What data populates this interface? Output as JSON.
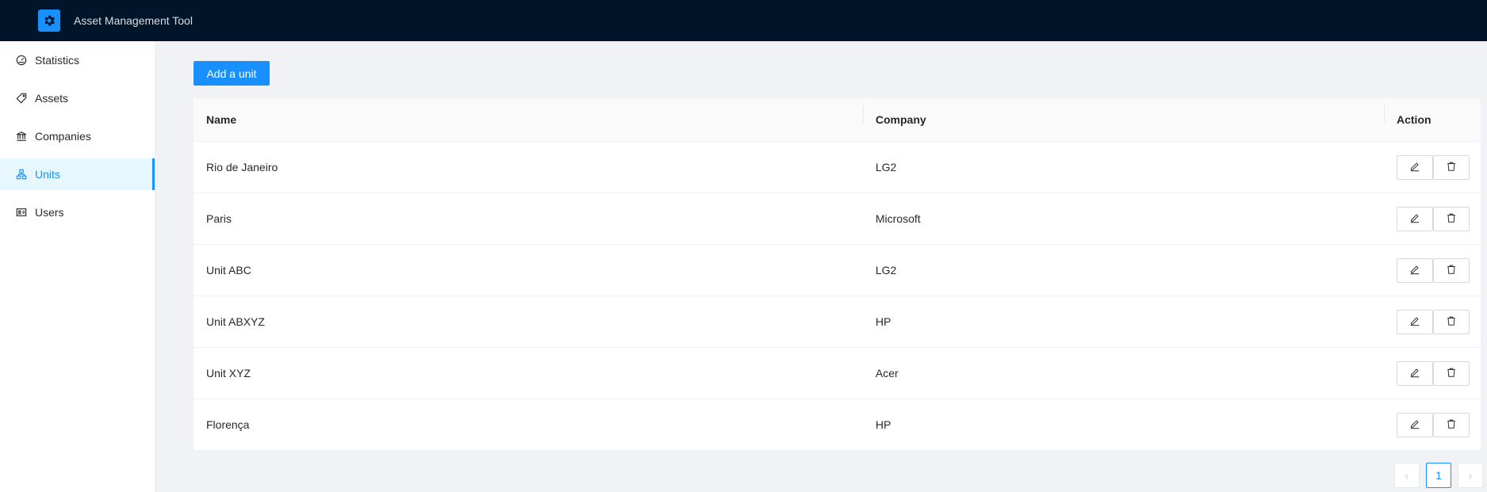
{
  "header": {
    "title": "Asset Management Tool",
    "logo_icon": "gear-icon"
  },
  "sidebar": {
    "items": [
      {
        "label": "Statistics",
        "icon": "dashboard-icon",
        "selected": false
      },
      {
        "label": "Assets",
        "icon": "tag-icon",
        "selected": false
      },
      {
        "label": "Companies",
        "icon": "bank-icon",
        "selected": false
      },
      {
        "label": "Units",
        "icon": "cluster-icon",
        "selected": true
      },
      {
        "label": "Users",
        "icon": "id-card-icon",
        "selected": false
      }
    ]
  },
  "toolbar": {
    "add_label": "Add a unit"
  },
  "table": {
    "columns": [
      "Name",
      "Company",
      "Action"
    ],
    "rows": [
      {
        "name": "Rio de Janeiro",
        "company": "LG2"
      },
      {
        "name": "Paris",
        "company": "Microsoft"
      },
      {
        "name": "Unit ABC",
        "company": "LG2"
      },
      {
        "name": "Unit ABXYZ",
        "company": "HP"
      },
      {
        "name": "Unit XYZ",
        "company": "Acer"
      },
      {
        "name": "Florença",
        "company": "HP"
      }
    ]
  },
  "pagination": {
    "current": "1",
    "prev": "‹",
    "next": "›"
  },
  "colors": {
    "accent": "#1890ff",
    "header_bg": "#001529",
    "page_bg": "#f0f2f5"
  }
}
